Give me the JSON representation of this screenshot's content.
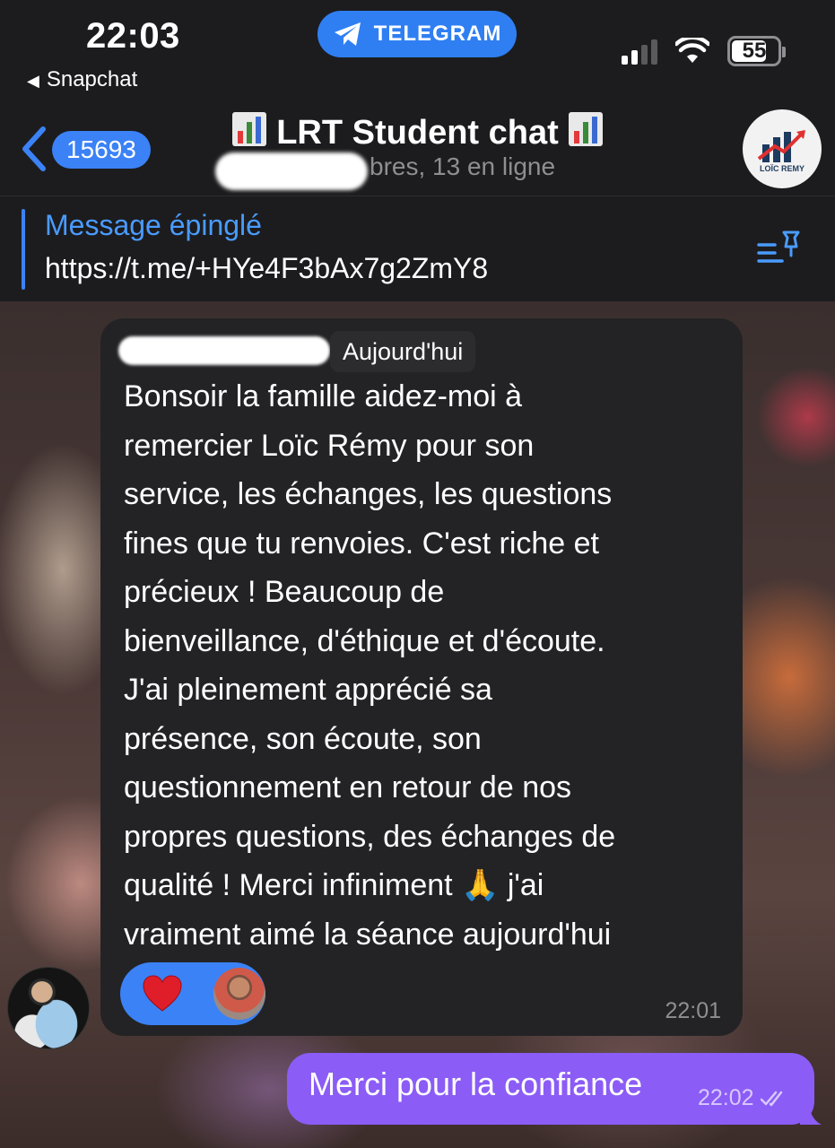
{
  "status_bar": {
    "time": "22:03",
    "back_app": "Snapchat",
    "app_badge": "TELEGRAM",
    "battery": "55"
  },
  "header": {
    "unread_count": "15693",
    "title": "LRT Student chat",
    "subtitle": "bres, 13 en ligne",
    "avatar_brand": "LOÏC REMY"
  },
  "pinned": {
    "label": "Message épinglé",
    "text": "https://t.me/+HYe4F3bAx7g2ZmY8"
  },
  "message": {
    "date_chip": "Aujourd'hui",
    "text": "Bonsoir la famille aidez-moi à\nremercier Loïc Rémy pour son\nservice, les échanges, les questions\nfines que tu renvoies. C'est riche et\nprécieux ! Beaucoup de\nbienveillance, d'éthique et d'écoute.\nJ'ai pleinement apprécié sa\nprésence, son écoute, son\nquestionnement en retour de nos\npropres questions, des échanges de\nqualité ! Merci infiniment 🙏 j'ai\nvraiment aimé la séance aujourd'hui",
    "time": "22:01",
    "reaction": "heart"
  },
  "reply": {
    "text": "Merci pour la confiance",
    "time": "22:02",
    "status": "read-double-check"
  },
  "colors": {
    "accent_blue": "#3b82f6",
    "outgoing_purple": "#8b5cf6",
    "bubble_dark": "#232325"
  }
}
